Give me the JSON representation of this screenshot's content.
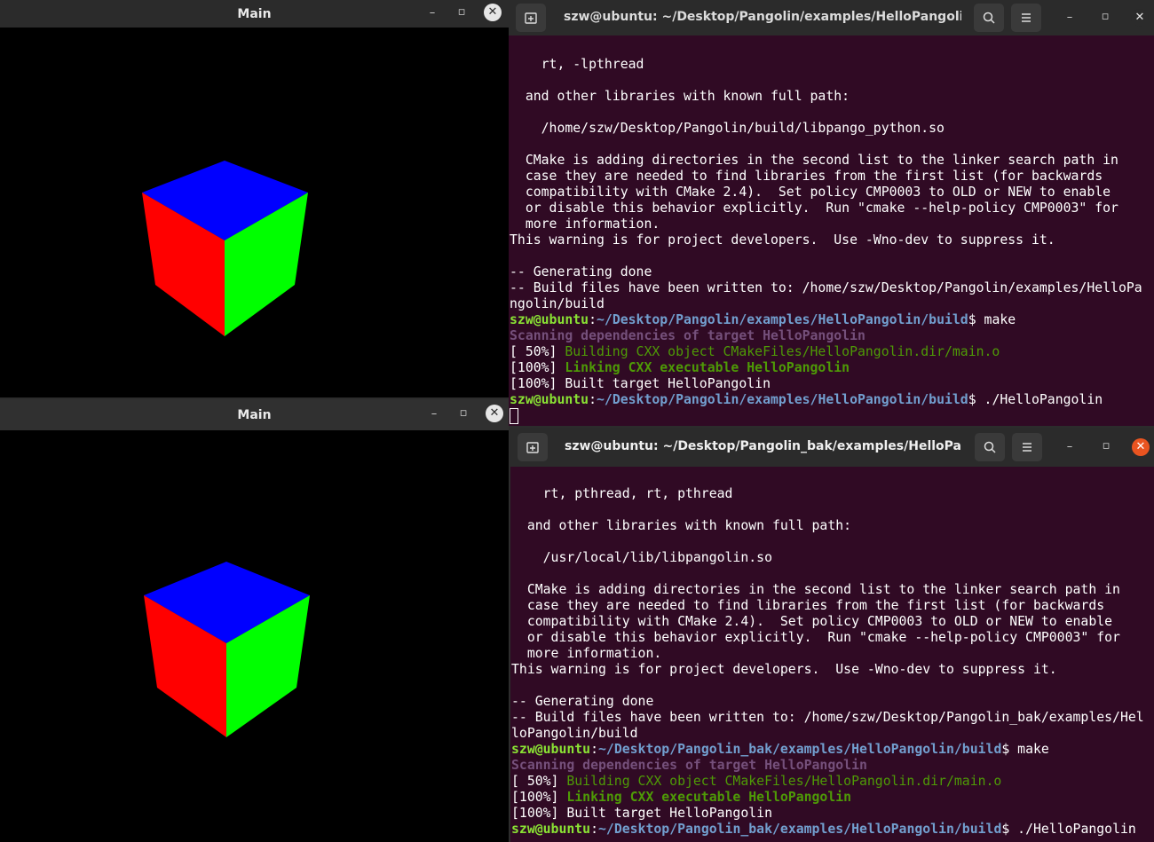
{
  "gl_windows": [
    {
      "title": "Main"
    },
    {
      "title": "Main"
    }
  ],
  "cube_colors": {
    "top": "#0000ff",
    "left": "#ff0000",
    "right": "#00ff00"
  },
  "terminals": [
    {
      "title": "szw@ubuntu: ~/Desktop/Pangolin/examples/HelloPangolin/...",
      "lines": [
        {
          "t": "    rt, -lpthread",
          "c": ""
        },
        {
          "t": "",
          "c": ""
        },
        {
          "t": "  and other libraries with known full path:",
          "c": ""
        },
        {
          "t": "",
          "c": ""
        },
        {
          "t": "    /home/szw/Desktop/Pangolin/build/libpango_python.so",
          "c": ""
        },
        {
          "t": "",
          "c": ""
        },
        {
          "t": "  CMake is adding directories in the second list to the linker search path in",
          "c": ""
        },
        {
          "t": "  case they are needed to find libraries from the first list (for backwards",
          "c": ""
        },
        {
          "t": "  compatibility with CMake 2.4).  Set policy CMP0003 to OLD or NEW to enable",
          "c": ""
        },
        {
          "t": "  or disable this behavior explicitly.  Run \"cmake --help-policy CMP0003\" for",
          "c": ""
        },
        {
          "t": "  more information.",
          "c": ""
        },
        {
          "t": "This warning is for project developers.  Use -Wno-dev to suppress it.",
          "c": ""
        },
        {
          "t": "",
          "c": ""
        },
        {
          "t": "-- Generating done",
          "c": ""
        },
        {
          "t": "-- Build files have been written to: /home/szw/Desktop/Pangolin/examples/HelloPa",
          "c": ""
        },
        {
          "t": "ngolin/build",
          "c": ""
        },
        {
          "prompt": true,
          "user": "szw@ubuntu",
          "path": "~/Desktop/Pangolin/examples/HelloPangolin/build",
          "cmd": "$ make"
        },
        {
          "t": "Scanning dependencies of target HelloPangolin",
          "c": "c-magenta"
        },
        {
          "pre": "[ 50%] ",
          "t": "Building CXX object CMakeFiles/HelloPangolin.dir/main.o",
          "c": "c-green"
        },
        {
          "pre": "[100%] ",
          "t": "Linking CXX executable HelloPangolin",
          "c": "c-bgreen"
        },
        {
          "t": "[100%] Built target HelloPangolin",
          "c": ""
        },
        {
          "prompt": true,
          "user": "szw@ubuntu",
          "path": "~/Desktop/Pangolin/examples/HelloPangolin/build",
          "cmd": "$ ./HelloPangolin"
        },
        {
          "cursor": true
        }
      ]
    },
    {
      "title": "szw@ubuntu: ~/Desktop/Pangolin_bak/examples/HelloPang...",
      "lines": [
        {
          "t": "    rt, pthread, rt, pthread",
          "c": ""
        },
        {
          "t": "",
          "c": ""
        },
        {
          "t": "  and other libraries with known full path:",
          "c": ""
        },
        {
          "t": "",
          "c": ""
        },
        {
          "t": "    /usr/local/lib/libpangolin.so",
          "c": ""
        },
        {
          "t": "",
          "c": ""
        },
        {
          "t": "  CMake is adding directories in the second list to the linker search path in",
          "c": ""
        },
        {
          "t": "  case they are needed to find libraries from the first list (for backwards",
          "c": ""
        },
        {
          "t": "  compatibility with CMake 2.4).  Set policy CMP0003 to OLD or NEW to enable",
          "c": ""
        },
        {
          "t": "  or disable this behavior explicitly.  Run \"cmake --help-policy CMP0003\" for",
          "c": ""
        },
        {
          "t": "  more information.",
          "c": ""
        },
        {
          "t": "This warning is for project developers.  Use -Wno-dev to suppress it.",
          "c": ""
        },
        {
          "t": "",
          "c": ""
        },
        {
          "t": "-- Generating done",
          "c": ""
        },
        {
          "t": "-- Build files have been written to: /home/szw/Desktop/Pangolin_bak/examples/Hel",
          "c": ""
        },
        {
          "t": "loPangolin/build",
          "c": ""
        },
        {
          "prompt": true,
          "user": "szw@ubuntu",
          "path": "~/Desktop/Pangolin_bak/examples/HelloPangolin/build",
          "cmd": "$ make"
        },
        {
          "t": "Scanning dependencies of target HelloPangolin",
          "c": "c-magenta"
        },
        {
          "pre": "[ 50%] ",
          "t": "Building CXX object CMakeFiles/HelloPangolin.dir/main.o",
          "c": "c-green"
        },
        {
          "pre": "[100%] ",
          "t": "Linking CXX executable HelloPangolin",
          "c": "c-bgreen"
        },
        {
          "t": "[100%] Built target HelloPangolin",
          "c": ""
        },
        {
          "prompt": true,
          "user": "szw@ubuntu",
          "path": "~/Desktop/Pangolin_bak/examples/HelloPangolin/build",
          "cmd": "$ ./HelloPangolin"
        }
      ]
    }
  ]
}
